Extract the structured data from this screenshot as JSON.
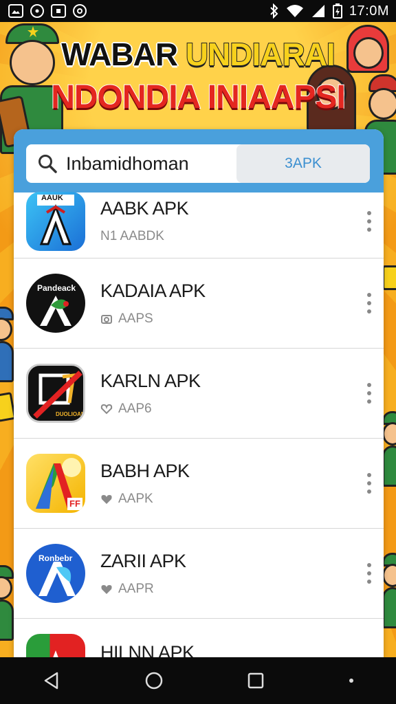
{
  "status_bar": {
    "time": "17:0M",
    "left_icons": [
      "gallery-icon",
      "target-icon",
      "image-icon",
      "settings-ring-icon"
    ],
    "right_icons": [
      "bluetooth-icon",
      "wifi-icon",
      "signal-icon",
      "battery-icon"
    ]
  },
  "banner": {
    "title_line_1_a": "WABAR ",
    "title_line_1_b": "UNDIARAI",
    "title_line_2": "NDONDIA INIAAPSI"
  },
  "search": {
    "value": "Inbamidhoman",
    "button_label": "3APK"
  },
  "apps": [
    {
      "name": "AABK APK",
      "meta": "N1 AABDK",
      "meta_icon": "none",
      "icon_style": "blue-a",
      "icon_text": "AAUK"
    },
    {
      "name": "KADAIA APK",
      "meta": "AAPS",
      "meta_icon": "camera-icon",
      "icon_style": "black-a",
      "icon_text": "Pandeack"
    },
    {
      "name": "KARLN APK",
      "meta": "AAP6",
      "meta_icon": "heart-outline-icon",
      "icon_style": "black-red",
      "icon_text": "DUOLIOAN"
    },
    {
      "name": "BABH APK",
      "meta": "AAPK",
      "meta_icon": "heart-icon",
      "icon_style": "yellow-a",
      "icon_text": "FF"
    },
    {
      "name": "ZARII APK",
      "meta": "AAPR",
      "meta_icon": "heart-icon",
      "icon_style": "blue-circle",
      "icon_text": "Ronbebr"
    },
    {
      "name": "HILNN APK",
      "meta": "",
      "meta_icon": "none",
      "icon_style": "green-red",
      "icon_text": ""
    }
  ],
  "colors": {
    "banner_orange": "#f4a21c",
    "card_header_blue": "#4aa0dc",
    "title_red": "#e42720",
    "title_yellow": "#f7d11c"
  },
  "nav": [
    "back-icon",
    "home-icon",
    "recents-icon",
    "dot-icon"
  ]
}
